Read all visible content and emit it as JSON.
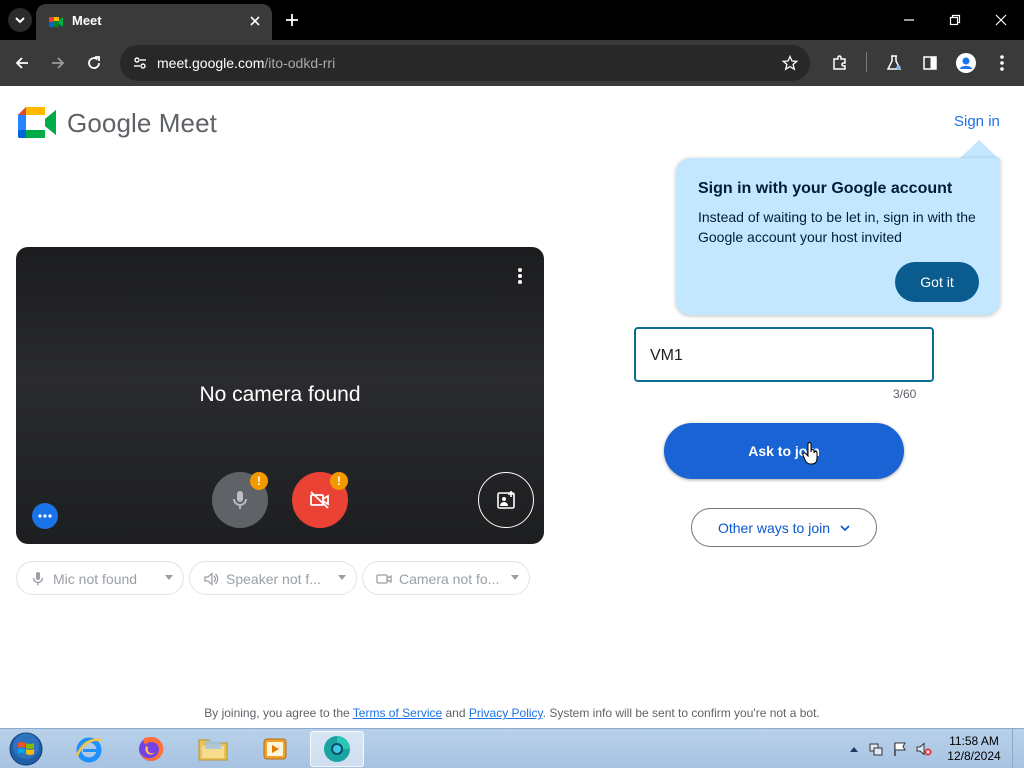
{
  "browser": {
    "tab": {
      "title": "Meet"
    },
    "url": {
      "host": "meet.google.com",
      "path": "/ito-odkd-rri"
    }
  },
  "meet": {
    "brand": "Google Meet",
    "sign_in": "Sign in",
    "tooltip": {
      "title": "Sign in with your Google account",
      "body": "Instead of waiting to be let in, sign in with the Google account your host invited",
      "button": "Got it"
    },
    "name_field": {
      "value": "VM1",
      "counter": "3/60"
    },
    "ask_to_join": "Ask to join",
    "other_ways": "Other ways to join",
    "preview": {
      "message": "No camera found",
      "warning_badge": "!"
    },
    "devices": {
      "mic": "Mic not found",
      "speaker": "Speaker not f...",
      "camera": "Camera not fo..."
    },
    "footer": {
      "prefix": "By joining, you agree to the ",
      "terms": "Terms of Service",
      "and": " and ",
      "privacy": "Privacy Policy",
      "suffix": ". System info will be sent to confirm you're not a bot."
    }
  },
  "taskbar": {
    "clock_time": "11:58 AM",
    "clock_date": "12/8/2024",
    "apps": [
      "start-orb",
      "internet-explorer",
      "firefox",
      "file-explorer",
      "media-player",
      "chrome-style-app"
    ]
  },
  "colors": {
    "accent": "#1a73e8",
    "ask_button": "#1a63d4",
    "tooltip_bg": "#c2e7ff",
    "got_it": "#0a5c8f",
    "camera_off": "#ea4335",
    "warning": "#f29900"
  }
}
